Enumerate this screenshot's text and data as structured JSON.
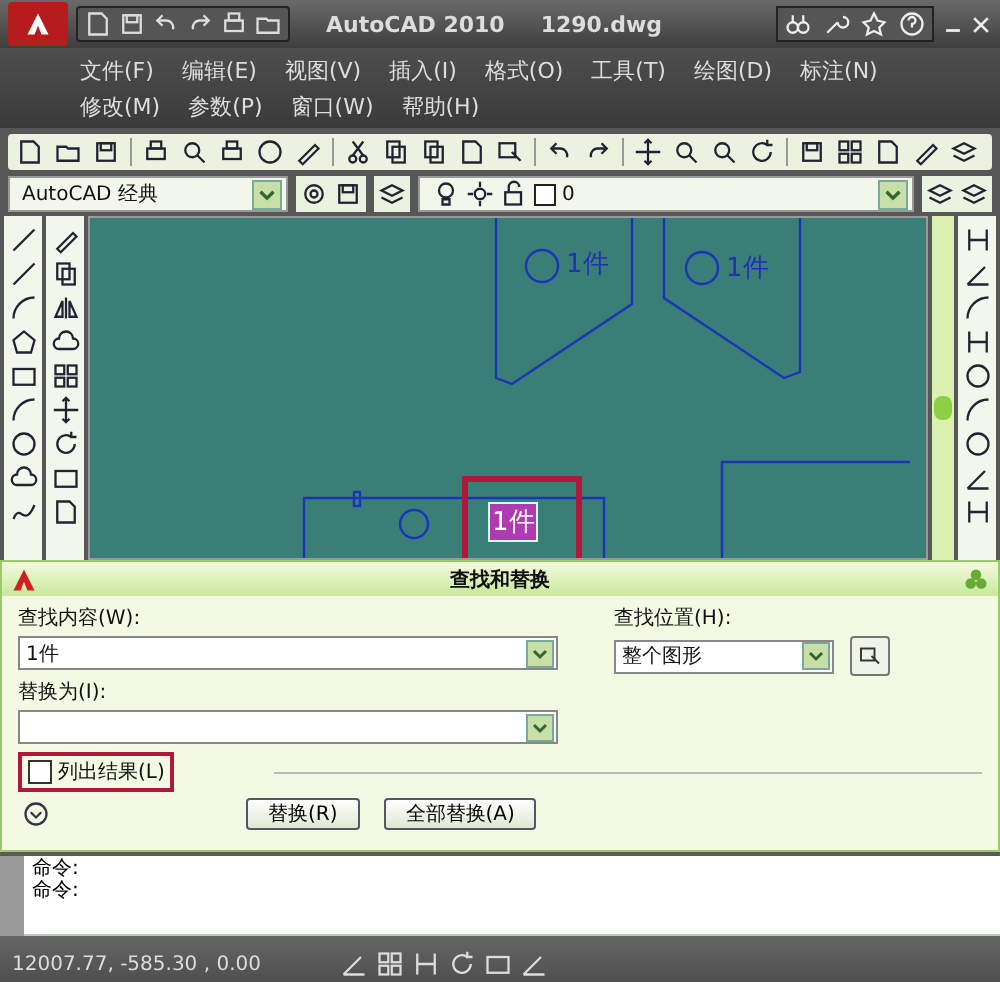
{
  "window": {
    "title": "AutoCAD 2010",
    "file": "1290.dwg"
  },
  "menu_rows": [
    [
      "文件(F)",
      "编辑(E)",
      "视图(V)",
      "插入(I)",
      "格式(O)",
      "工具(T)",
      "绘图(D)",
      "标注(N)"
    ],
    [
      "修改(M)",
      "参数(P)",
      "窗口(W)",
      "帮助(H)"
    ]
  ],
  "workspace": {
    "value": "AutoCAD 经典"
  },
  "layer": {
    "value": "0"
  },
  "drawing": {
    "labels": [
      {
        "text": "1件",
        "selected": false
      },
      {
        "text": "1件",
        "selected": false
      },
      {
        "text": "1件",
        "selected": true
      }
    ]
  },
  "dialog": {
    "title": "查找和替换",
    "find_label": "查找内容(W):",
    "find_value": "1件",
    "replace_label": "替换为(I):",
    "location_label": "查找位置(H):",
    "location_value": "整个图形",
    "list_results": {
      "label": "列出结果(L)",
      "checked": false
    },
    "buttons": [
      "替换(R)",
      "全部替换(A)"
    ]
  },
  "command_lines": [
    "命令:",
    "命令:"
  ],
  "status_bar": {
    "coordinates": "12007.77, -585.30 , 0.00"
  }
}
